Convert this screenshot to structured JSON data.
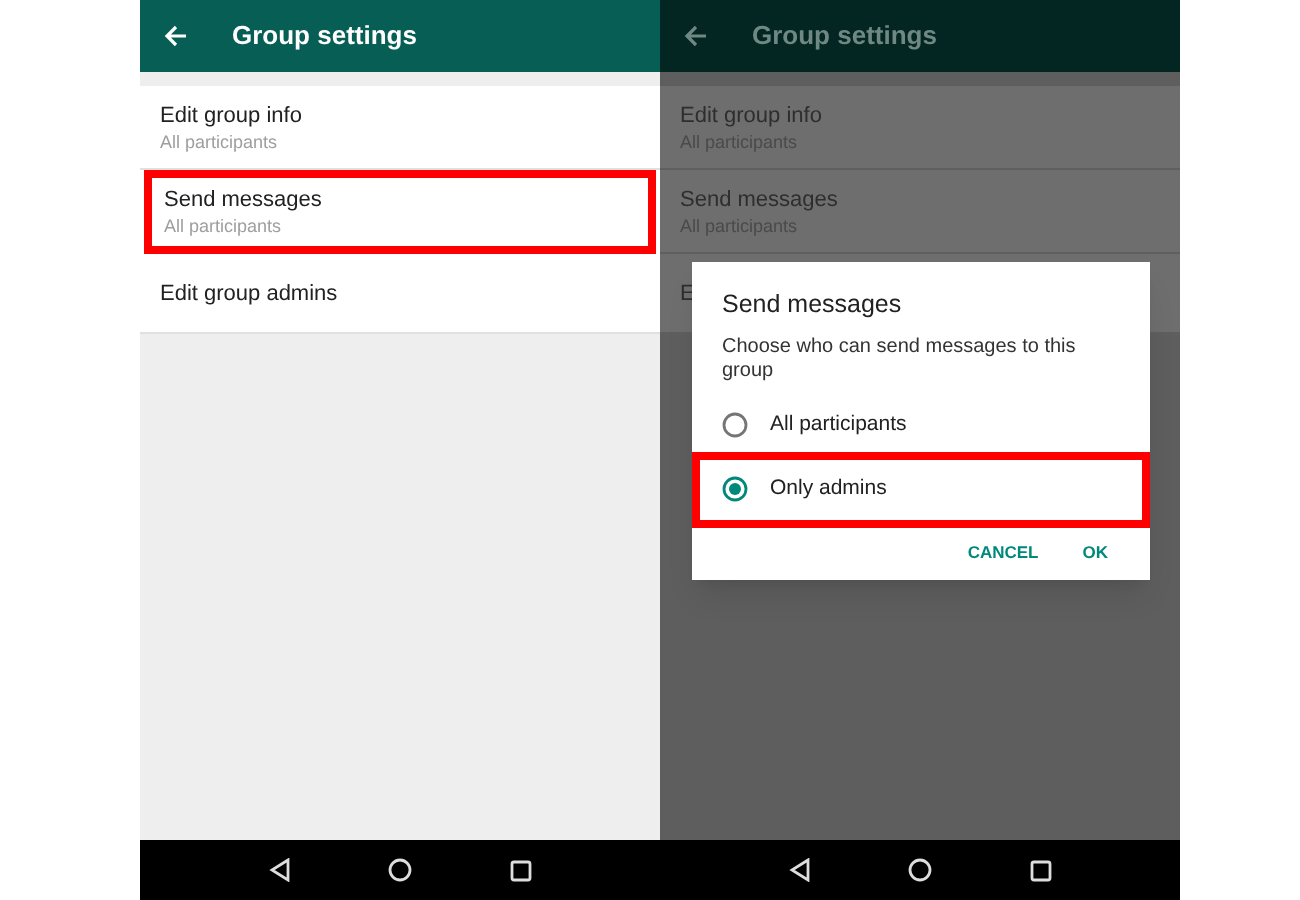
{
  "screens": [
    {
      "dimmed": false,
      "header": {
        "title": "Group settings"
      },
      "rows": [
        {
          "title": "Edit group info",
          "subtitle": "All participants",
          "highlighted": false
        },
        {
          "title": "Send messages",
          "subtitle": "All participants",
          "highlighted": true
        },
        {
          "title": "Edit group admins",
          "highlighted": false
        }
      ]
    },
    {
      "dimmed": true,
      "header": {
        "title": "Group settings"
      },
      "rows": [
        {
          "title": "Edit group info",
          "subtitle": "All participants",
          "highlighted": false
        },
        {
          "title": "Send messages",
          "subtitle": "All participants",
          "highlighted": false
        },
        {
          "title": "E",
          "highlighted": false
        }
      ],
      "dialog": {
        "title": "Send messages",
        "message": "Choose who can send messages to this group",
        "options": [
          {
            "label": "All participants",
            "selected": false,
            "highlighted": false
          },
          {
            "label": "Only admins",
            "selected": true,
            "highlighted": true
          }
        ],
        "buttons": [
          "CANCEL",
          "OK"
        ]
      }
    }
  ]
}
